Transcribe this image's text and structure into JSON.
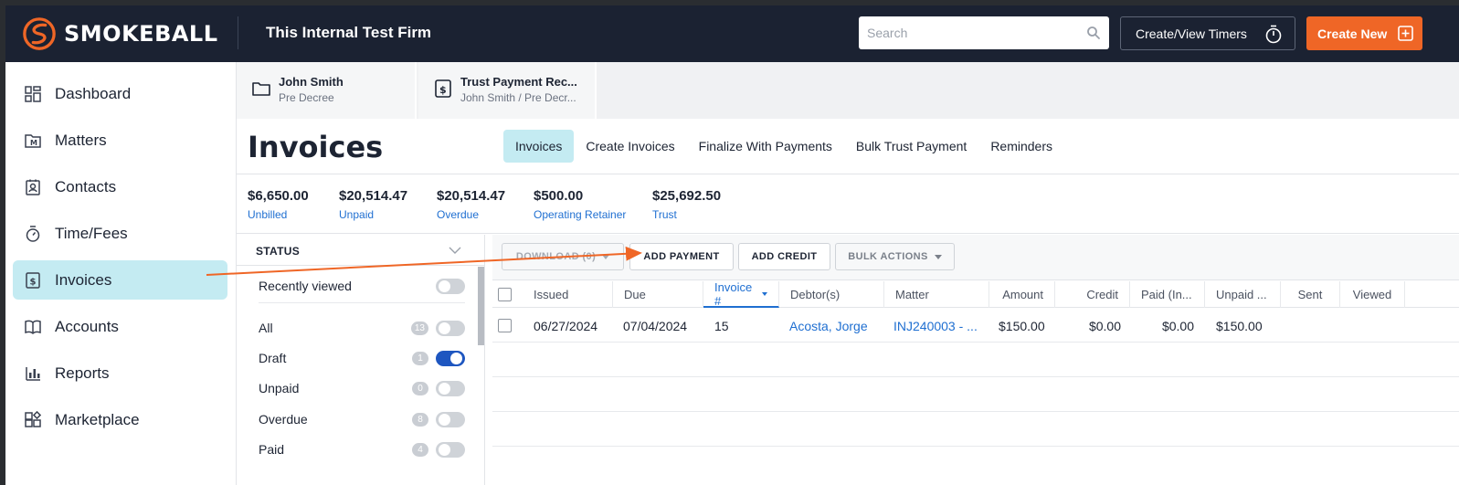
{
  "header": {
    "brand": "SMOKEBALL",
    "firm_name": "This Internal Test Firm",
    "search_placeholder": "Search",
    "timers_label": "Create/View Timers",
    "create_label": "Create New",
    "brand_color": "#ef6626"
  },
  "sidebar": {
    "items": [
      {
        "label": "Dashboard",
        "icon": "dashboard-icon"
      },
      {
        "label": "Matters",
        "icon": "matters-icon"
      },
      {
        "label": "Contacts",
        "icon": "contacts-icon"
      },
      {
        "label": "Time/Fees",
        "icon": "stopwatch-icon"
      },
      {
        "label": "Invoices",
        "icon": "invoice-icon",
        "active": true
      },
      {
        "label": "Accounts",
        "icon": "accounts-icon"
      },
      {
        "label": "Reports",
        "icon": "reports-icon"
      },
      {
        "label": "Marketplace",
        "icon": "marketplace-icon"
      }
    ]
  },
  "matter_tabs": [
    {
      "title": "John Smith",
      "subtitle": "Pre Decree",
      "icon": "folder-icon"
    },
    {
      "title": "Trust Payment Rec...",
      "subtitle": "John Smith / Pre Decr...",
      "icon": "dollar-doc-icon"
    }
  ],
  "page": {
    "title": "Invoices",
    "tabs": [
      "Invoices",
      "Create Invoices",
      "Finalize With Payments",
      "Bulk Trust Payment",
      "Reminders"
    ],
    "active_tab": "Invoices"
  },
  "summary": [
    {
      "amount": "$6,650.00",
      "label": "Unbilled"
    },
    {
      "amount": "$20,514.47",
      "label": "Unpaid"
    },
    {
      "amount": "$20,514.47",
      "label": "Overdue"
    },
    {
      "amount": "$500.00",
      "label": "Operating Retainer"
    },
    {
      "amount": "$25,692.50",
      "label": "Trust"
    }
  ],
  "status_filter": {
    "heading": "STATUS",
    "recently_viewed": "Recently viewed",
    "items": [
      {
        "label": "All",
        "count": "13",
        "on": false
      },
      {
        "label": "Draft",
        "count": "1",
        "on": true
      },
      {
        "label": "Unpaid",
        "count": "0",
        "on": false
      },
      {
        "label": "Overdue",
        "count": "8",
        "on": false
      },
      {
        "label": "Paid",
        "count": "4",
        "on": false
      }
    ]
  },
  "toolbar": {
    "download": "DOWNLOAD (0)",
    "add_payment": "ADD PAYMENT",
    "add_credit": "ADD CREDIT",
    "bulk_actions": "BULK ACTIONS"
  },
  "table": {
    "columns": [
      "Issued",
      "Due",
      "Invoice #",
      "Debtor(s)",
      "Matter",
      "Amount",
      "Credit",
      "Paid (In...",
      "Unpaid ...",
      "Sent",
      "Viewed"
    ],
    "rows": [
      {
        "issued": "06/27/2024",
        "due": "07/04/2024",
        "invoice": "15",
        "debtor": "Acosta, Jorge",
        "matter": "INJ240003 - ...",
        "amount": "$150.00",
        "credit": "$0.00",
        "paid": "$0.00",
        "unpaid": "$150.00",
        "sent": "",
        "viewed": ""
      }
    ]
  }
}
